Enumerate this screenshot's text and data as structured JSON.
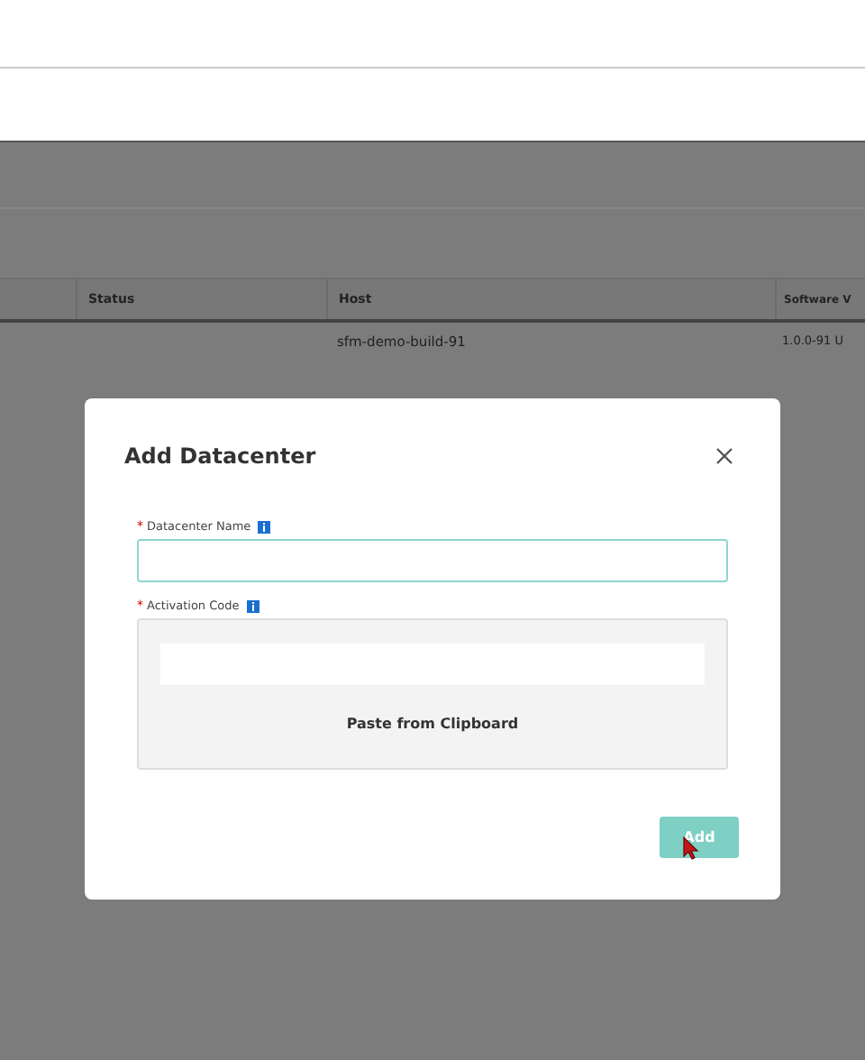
{
  "table": {
    "columns": [
      "Status",
      "Host",
      "Software V"
    ],
    "rows": [
      [
        "",
        "sfm-demo-build-91",
        "1.0.0-91 U"
      ]
    ]
  },
  "dialog": {
    "title": "Add Datacenter",
    "fields": [
      {
        "kind": "text",
        "label": "Datacenter Name",
        "required_mark": "*"
      },
      {
        "kind": "paste",
        "label": "Activation Code",
        "required_mark": "*",
        "action": "Paste from Clipboard"
      }
    ],
    "button": {
      "label": "Add",
      "disabled": true
    }
  }
}
